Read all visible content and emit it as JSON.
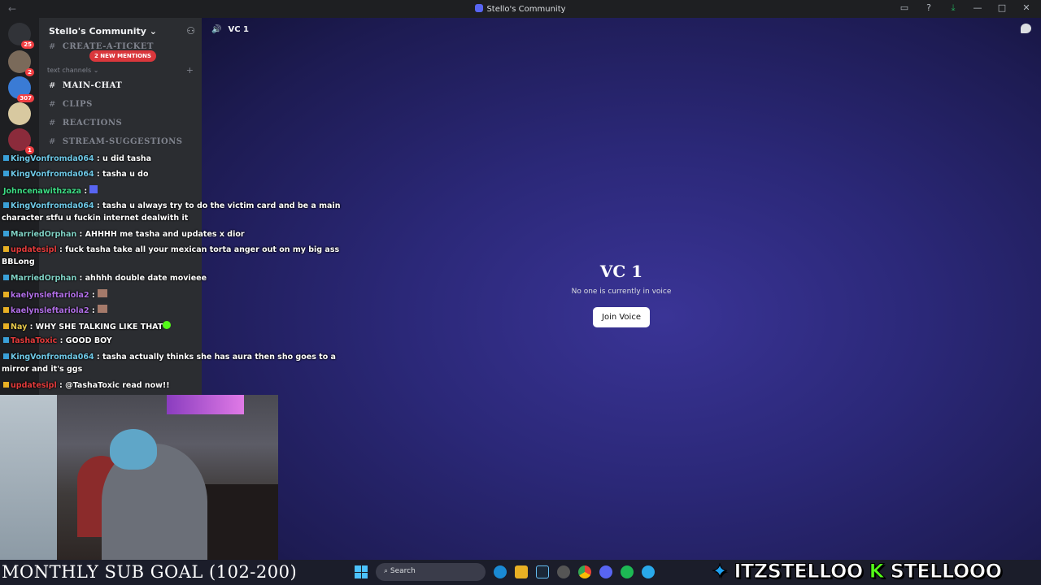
{
  "titlebar": {
    "title": "Stello's Community"
  },
  "server": {
    "name": "Stello's Community ⌄"
  },
  "guild_badges": [
    "25",
    "2",
    "307",
    "1"
  ],
  "channels": {
    "top": "CREATE-A-TICKET",
    "mentions": "2 NEW MENTIONS",
    "category": "text channels ⌄",
    "items": [
      "MAIN-CHAT",
      "CLIPS",
      "REACTIONS",
      "STREAM-SUGGESTIONS"
    ]
  },
  "voice": {
    "header": "VC 1",
    "title": "VC 1",
    "subtitle": "No one is currently in voice",
    "join": "Join Voice"
  },
  "chat": [
    {
      "user": "KingVonfromda064",
      "text": " : u did tasha",
      "color": "#6ec8e6"
    },
    {
      "user": "KingVonfromda064",
      "text": " : tasha u do",
      "color": "#6ec8e6"
    },
    {
      "user": "Johncenawithzaza",
      "text": " : ",
      "color": "#3ddc84"
    },
    {
      "user": "KingVonfromda064",
      "text": " : tasha u always try to do the victim card and be a main",
      "wrap": "character stfu u fuckin internet dealwith it",
      "color": "#6ec8e6"
    },
    {
      "user": "MarriedOrphan",
      "text": " : AHHHH me tasha and updates x dior",
      "color": "#7fd1c4"
    },
    {
      "user": "updatesipl",
      "text": " : fuck tasha take all your mexican torta anger out on my big ass",
      "wrap": "BBLong",
      "color": "#e23b3b"
    },
    {
      "user": "MarriedOrphan",
      "text": " : ahhhh double date movieee",
      "color": "#7fd1c4"
    },
    {
      "user": "kaelynsleftariola2",
      "text": " : ",
      "color": "#b06ee6"
    },
    {
      "user": "kaelynsleftariola2",
      "text": " : ",
      "color": "#b06ee6"
    },
    {
      "user": "Nay",
      "text": " : WHY SHE TALKING LIKE THAT",
      "color": "#e6c84a"
    },
    {
      "user": "TashaToxic",
      "text": " : GOOD BOY",
      "color": "#e23b3b"
    },
    {
      "user": "KingVonfromda064",
      "text": " : tasha actually thinks she has aura then sho goes to a",
      "wrap": "mirror and it's ggs",
      "color": "#6ec8e6"
    },
    {
      "user": "updatesipl",
      "text": " : @TashaToxic read now!!",
      "color": "#e23b3b"
    }
  ],
  "bottom": {
    "subgoal": "MONTHLY SUB GOAL (102-200)",
    "search": "Search",
    "twitter": "ITZSTELLOO",
    "kick": "STELLOOO"
  }
}
